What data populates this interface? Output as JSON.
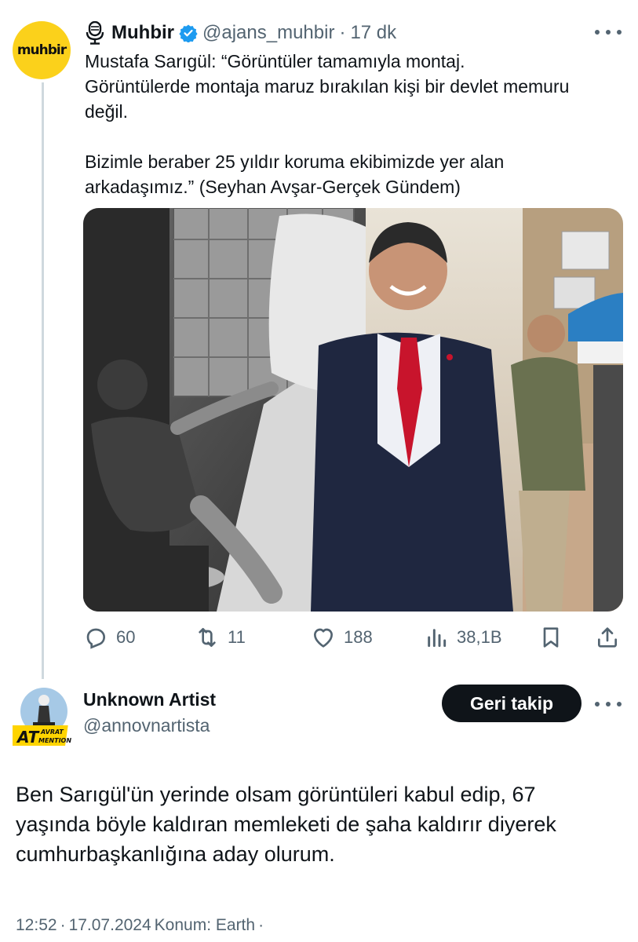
{
  "quoted_tweet": {
    "avatar_text": "muhbir",
    "author_name": "Muhbir",
    "author_handle": "@ajans_muhbir",
    "separator": "·",
    "time_ago": "17 dk",
    "paragraph_1": "Mustafa Sarıgül: “Görüntüler tamamıyla montaj.\nGörüntülerde montaja maruz bırakılan kişi bir devlet memuru\ndeğil.",
    "paragraph_2": "Bizimle beraber 25 yıldır koruma ekibimizde yer alan\narkadaşımız.” (Seyhan Avşar-Gerçek Gündem)",
    "actions": {
      "replies": "60",
      "reposts": "11",
      "likes": "188",
      "views": "38,1B"
    },
    "icons": [
      "microphone-icon",
      "verified-badge-icon",
      "more-icon",
      "reply-icon",
      "repost-icon",
      "like-icon",
      "views-icon",
      "bookmark-icon",
      "share-icon"
    ]
  },
  "reply_tweet": {
    "author_name": "Unknown Artist",
    "author_handle": "@annovnartista",
    "avatar_badge_text": "AT",
    "avatar_badge_sub_1": "AVRAT",
    "avatar_badge_sub_2": "MENTION",
    "follow_button_label": "Geri takip",
    "text": "Ben Sarıgül'ün yerinde olsam görüntüleri kabul edip, 67\nyaşında böyle kaldıran memleketi de şaha kaldırır diyerek\ncumhurbaşkanlığına aday olurum.",
    "footer": {
      "time": "12:52",
      "date": "17.07.2024",
      "location": "Konum: Earth",
      "separator": "·"
    }
  },
  "colors": {
    "text_primary": "#0f1419",
    "text_secondary": "#536471",
    "verified_blue": "#1d9bf0",
    "muhbir_yellow": "#fbd11b",
    "follow_button_bg": "#0f1419",
    "thread_line": "#cfd9de"
  }
}
